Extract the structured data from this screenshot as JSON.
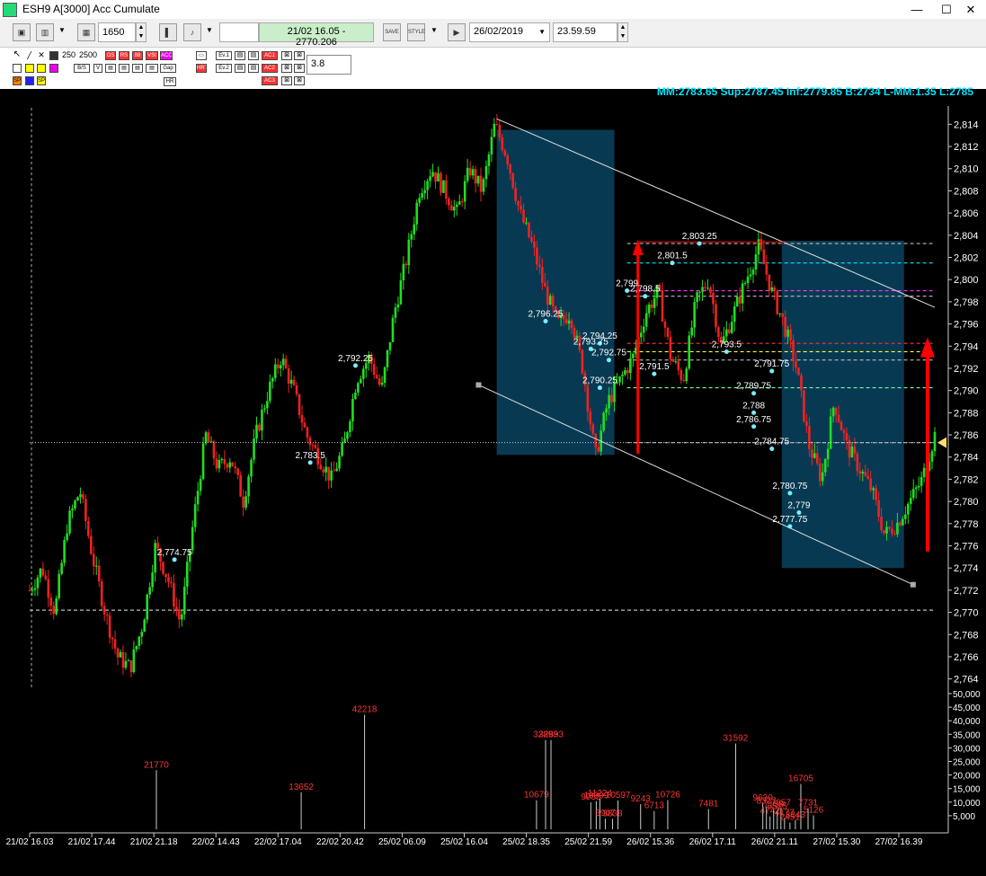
{
  "window": {
    "title": "ESH9 A[3000] Acc Cumulate",
    "minimize": "—",
    "maximize": "☐",
    "close": "✕"
  },
  "toolbar": {
    "bars_value": "1650",
    "info": "21/02 16.05 - 2770.206",
    "date": "26/02/2019",
    "time": "23.59.59",
    "zoom_250": "250",
    "zoom_2500": "2500",
    "indicator_labels": [
      "OS",
      "RS",
      "88",
      "VSI",
      "ACC",
      "Ev.1",
      "AC1",
      "Gap",
      "HRT",
      "Ev.2",
      "AC2",
      "AC3",
      "HR",
      "BS"
    ],
    "threshold": "3.8"
  },
  "stats": "MM:2783.65 Sup:2787.45 Inf:2779.85 B:2734 L-MM:1.35 L:2785",
  "colors": {
    "up": "#22dd22",
    "down": "#ee2222",
    "box": "#073a52",
    "accent": "#00e5ff"
  },
  "chart_data": {
    "type": "candlestick-volume",
    "ylim": [
      2763,
      2815
    ],
    "y_ticks": [
      "2,814",
      "2,812",
      "2,810",
      "2,808",
      "2,806",
      "2,804",
      "2,802",
      "2,800",
      "2,798",
      "2,796",
      "2,794",
      "2,792",
      "2,790",
      "2,788",
      "2,786",
      "2,784",
      "2,782",
      "2,780",
      "2,778",
      "2,776",
      "2,774",
      "2,772",
      "2,770",
      "2,768",
      "2,766",
      "2,764"
    ],
    "vol_ticks": [
      "50,000",
      "45,000",
      "40,000",
      "35,000",
      "30,000",
      "25,000",
      "20,000",
      "15,000",
      "10,000",
      "5,000"
    ],
    "vol_ylim": [
      0,
      50000
    ],
    "x_ticks": [
      "21/02 16.03",
      "21/02 17.44",
      "21/02 21.18",
      "22/02 14.43",
      "22/02 17.04",
      "22/02 20.42",
      "25/02 06.09",
      "25/02 16.04",
      "25/02 18.35",
      "25/02 21.59",
      "26/02 15.36",
      "26/02 17.11",
      "26/02 21.11",
      "27/02 15.30",
      "27/02 16.39"
    ],
    "price_path": [
      2772,
      2774,
      2770,
      2778,
      2781,
      2775,
      2770,
      2766,
      2765,
      2769,
      2776,
      2773,
      2769,
      2778,
      2786,
      2783,
      2784,
      2780,
      2786,
      2790,
      2793,
      2790,
      2786,
      2784,
      2782,
      2785,
      2791,
      2793,
      2790,
      2797,
      2802,
      2808,
      2810,
      2808,
      2806,
      2810,
      2808,
      2814,
      2811,
      2806,
      2803,
      2799,
      2796,
      2797,
      2792,
      2784,
      2789,
      2791,
      2793,
      2797,
      2799,
      2793,
      2791,
      2798,
      2800,
      2794,
      2797,
      2800,
      2803,
      2799,
      2796,
      2792,
      2785,
      2782,
      2789,
      2785,
      2783,
      2781,
      2777,
      2778,
      2780,
      2782,
      2786
    ],
    "price_labels": [
      {
        "t": "2,803.25",
        "x": 74,
        "y": 2803.25
      },
      {
        "t": "2,801.5",
        "x": 71,
        "y": 2801.5
      },
      {
        "t": "2,799",
        "x": 66,
        "y": 2799
      },
      {
        "t": "2,798.5",
        "x": 68,
        "y": 2798.5
      },
      {
        "t": "2,796.25",
        "x": 57,
        "y": 2796.25
      },
      {
        "t": "2,794.25",
        "x": 63,
        "y": 2794.25
      },
      {
        "t": "2,793.75",
        "x": 62,
        "y": 2793.75
      },
      {
        "t": "2,793.5",
        "x": 77,
        "y": 2793.5
      },
      {
        "t": "2,792.75",
        "x": 64,
        "y": 2792.75
      },
      {
        "t": "2,792.25",
        "x": 36,
        "y": 2792.25
      },
      {
        "t": "2,791.5",
        "x": 69,
        "y": 2791.5
      },
      {
        "t": "2,790.25",
        "x": 63,
        "y": 2790.25
      },
      {
        "t": "2,791.75",
        "x": 82,
        "y": 2791.75
      },
      {
        "t": "2,789.75",
        "x": 80,
        "y": 2789.75
      },
      {
        "t": "2,788",
        "x": 80,
        "y": 2788
      },
      {
        "t": "2,786.75",
        "x": 80,
        "y": 2786.75
      },
      {
        "t": "2,784.75",
        "x": 82,
        "y": 2784.75
      },
      {
        "t": "2,783.5",
        "x": 31,
        "y": 2783.5
      },
      {
        "t": "2,780.75",
        "x": 84,
        "y": 2780.75
      },
      {
        "t": "2,779",
        "x": 85,
        "y": 2779
      },
      {
        "t": "2,777.75",
        "x": 84,
        "y": 2777.75
      },
      {
        "t": "2,774.75",
        "x": 16,
        "y": 2774.75
      }
    ],
    "h_levels": [
      {
        "y": 2803.25,
        "color": "#bbbbbb"
      },
      {
        "y": 2801.5,
        "color": "#00e5ff"
      },
      {
        "y": 2799,
        "color": "#ff33ff"
      },
      {
        "y": 2798.5,
        "color": "#bbbbbb"
      },
      {
        "y": 2794.25,
        "color": "#ff3333"
      },
      {
        "y": 2793.5,
        "color": "#ffff33"
      },
      {
        "y": 2792.75,
        "color": "#bbbbbb"
      },
      {
        "y": 2790.25,
        "color": "#66ffaa"
      },
      {
        "y": 2785.3,
        "color": "#bbbbbb"
      },
      {
        "y": 2770.2,
        "color": "#bbbbbb"
      }
    ],
    "volume": [
      {
        "x": 14,
        "v": 21770,
        "c": "#ff3333"
      },
      {
        "x": 30,
        "v": 13652,
        "c": "#ff3333"
      },
      {
        "x": 37,
        "v": 42218,
        "c": "#ff3333"
      },
      {
        "x": 56,
        "v": 10679,
        "c": "#ff3333"
      },
      {
        "x": 57,
        "v": 32893,
        "c": "#ff3333"
      },
      {
        "x": 57.6,
        "v": 32893,
        "c": "#ff3333"
      },
      {
        "x": 62,
        "v": 9955,
        "c": "#ff3333"
      },
      {
        "x": 62.6,
        "v": 10399,
        "c": "#ff3333"
      },
      {
        "x": 63,
        "v": 11224,
        "c": "#ff3333"
      },
      {
        "x": 63.6,
        "v": 3907,
        "c": "#ff3333"
      },
      {
        "x": 64.4,
        "v": 3838,
        "c": "#ff3333"
      },
      {
        "x": 65,
        "v": 10597,
        "c": "#ff3333"
      },
      {
        "x": 67.5,
        "v": 9243,
        "c": "#ff3333"
      },
      {
        "x": 69,
        "v": 6713,
        "c": "#ff3333"
      },
      {
        "x": 70.5,
        "v": 10726,
        "c": "#ff3333"
      },
      {
        "x": 75,
        "v": 7481,
        "c": "#ff3333"
      },
      {
        "x": 78,
        "v": 31592,
        "c": "#ff3333"
      },
      {
        "x": 81,
        "v": 9630,
        "c": "#ff3333"
      },
      {
        "x": 81.4,
        "v": 8377,
        "c": "#ff3333"
      },
      {
        "x": 81.8,
        "v": 4742,
        "c": "#ff3333"
      },
      {
        "x": 82.2,
        "v": 7158,
        "c": "#ff3333"
      },
      {
        "x": 82.6,
        "v": 6525,
        "c": "#ff3333"
      },
      {
        "x": 83,
        "v": 7857,
        "c": "#ff3333"
      },
      {
        "x": 83.4,
        "v": 4177,
        "c": "#ff3333"
      },
      {
        "x": 84,
        "v": 2451,
        "c": "#ff3333"
      },
      {
        "x": 84.6,
        "v": 3343,
        "c": "#ff3333"
      },
      {
        "x": 85.2,
        "v": 16705,
        "c": "#ff3333"
      },
      {
        "x": 86,
        "v": 7731,
        "c": "#ff3333"
      },
      {
        "x": 86.6,
        "v": 5126,
        "c": "#ff3333"
      }
    ],
    "volume_labels": [
      "21770",
      "13652",
      "42218",
      "10679",
      "32893",
      "32893",
      "9955",
      "10399",
      "11224",
      "3907",
      "3838",
      "10597",
      "9243",
      "6713",
      "10726",
      "7481",
      "31592",
      "9630",
      "8377",
      "4742",
      "7158",
      "6525",
      "7857",
      "4177",
      "2451",
      "3343",
      "16705",
      "7731",
      "5126"
    ]
  }
}
